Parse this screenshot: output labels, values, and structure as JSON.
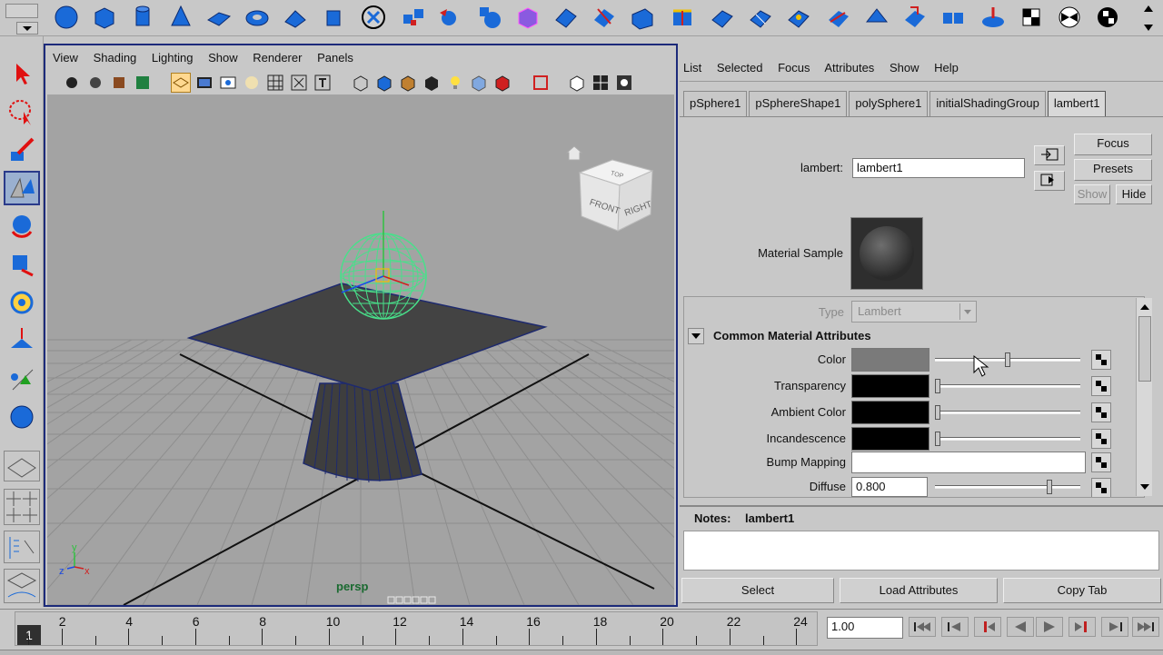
{
  "viewport": {
    "menu": [
      "View",
      "Shading",
      "Lighting",
      "Show",
      "Renderer",
      "Panels"
    ],
    "camera_label": "persp",
    "viewcube": {
      "front": "FRONT",
      "right": "RIGHT",
      "top": "TOP"
    },
    "axis": {
      "x": "x",
      "y": "y",
      "z": "z"
    }
  },
  "attribute_editor": {
    "menu": [
      "List",
      "Selected",
      "Focus",
      "Attributes",
      "Show",
      "Help"
    ],
    "tabs": [
      "pSphere1",
      "pSphereShape1",
      "polySphere1",
      "initialShadingGroup",
      "lambert1"
    ],
    "active_tab": "lambert1",
    "node_type_label": "lambert:",
    "node_name": "lambert1",
    "buttons": {
      "focus": "Focus",
      "presets": "Presets",
      "show": "Show",
      "hide": "Hide"
    },
    "material_sample_label": "Material Sample",
    "type_label": "Type",
    "type_value": "Lambert",
    "section_title": "Common Material Attributes",
    "attributes": [
      {
        "label": "Color",
        "color": "#7a7a7a",
        "slider": 0.5
      },
      {
        "label": "Transparency",
        "color": "#000000",
        "slider": 0.0
      },
      {
        "label": "Ambient Color",
        "color": "#000000",
        "slider": 0.0
      },
      {
        "label": "Incandescence",
        "color": "#000000",
        "slider": 0.0
      }
    ],
    "bump_mapping_label": "Bump Mapping",
    "diffuse_label": "Diffuse",
    "diffuse_value": "0.800",
    "diffuse_slider": 0.8,
    "notes_label": "Notes:",
    "notes_name": "lambert1",
    "bottom_buttons": {
      "select": "Select",
      "load": "Load Attributes",
      "copy": "Copy Tab"
    }
  },
  "timeline": {
    "current_frame": "1",
    "ticks": [
      "2",
      "4",
      "6",
      "8",
      "10",
      "12",
      "14",
      "16",
      "18",
      "20",
      "22",
      "24"
    ],
    "current_time_field": "1.00"
  },
  "colors": {
    "ui_bg": "#c8c8c8",
    "viewport_bg": "#a3a3a3",
    "panel_border": "#1c2a7a",
    "wireframe": "#48e08a"
  }
}
